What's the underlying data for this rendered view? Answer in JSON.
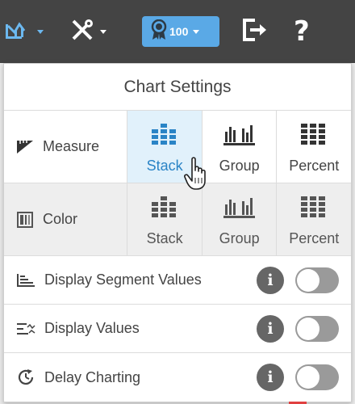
{
  "toolbar": {
    "chart_icon": "chart-icon",
    "tools_icon": "tools-icon",
    "badge_icon": "award-ribbon-icon",
    "badge_count": "100",
    "logout_icon": "logout-icon",
    "help_label": "?"
  },
  "panel": {
    "title": "Chart Settings",
    "measure": {
      "label": "Measure",
      "icon": "measure-ruler-icon",
      "options": [
        "Stack",
        "Group",
        "Percent"
      ],
      "selected": "Stack"
    },
    "color": {
      "label": "Color",
      "icon": "color-palette-icon",
      "options": [
        "Stack",
        "Group",
        "Percent"
      ]
    },
    "toggles": [
      {
        "label": "Display Segment Values",
        "icon": "segment-values-icon",
        "on": false
      },
      {
        "label": "Display Values",
        "icon": "values-icon",
        "on": false
      },
      {
        "label": "Delay Charting",
        "icon": "delay-clock-icon",
        "on": false
      }
    ],
    "info_label": "i"
  },
  "colors": {
    "topbar": "#444444",
    "accent": "#2a84c6",
    "badge": "#5aa9e6",
    "selected_bg": "#e1f1fb"
  }
}
